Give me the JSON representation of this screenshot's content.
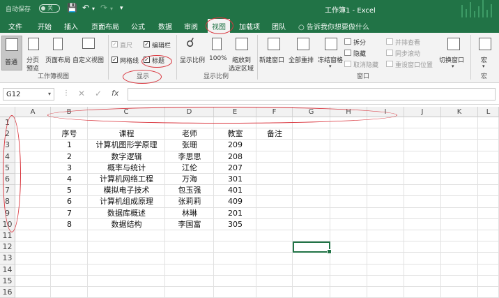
{
  "titlebar": {
    "autosave_label": "自动保存",
    "autosave_state": "关",
    "doc_title": "工作簿1 - Excel"
  },
  "tabs": [
    {
      "label": "文件",
      "active": false
    },
    {
      "label": "开始",
      "active": false
    },
    {
      "label": "插入",
      "active": false
    },
    {
      "label": "页面布局",
      "active": false
    },
    {
      "label": "公式",
      "active": false
    },
    {
      "label": "数据",
      "active": false
    },
    {
      "label": "审阅",
      "active": false
    },
    {
      "label": "视图",
      "active": true
    },
    {
      "label": "加载项",
      "active": false
    },
    {
      "label": "团队",
      "active": false
    }
  ],
  "tell_me": "告诉我你想要做什么",
  "ribbon": {
    "workbook_views": {
      "normal": "普通",
      "page_break_1": "分页",
      "page_break_2": "预览",
      "page_layout": "页面布局",
      "custom_views": "自定义视图",
      "group": "工作簿视图"
    },
    "show": {
      "ruler": "直尺",
      "formula_bar": "编辑栏",
      "gridlines": "网格线",
      "headings": "标题",
      "group": "显示"
    },
    "zoom": {
      "zoom": "显示比例",
      "zoom_100": "100%",
      "zoom_sel_1": "缩放到",
      "zoom_sel_2": "选定区域",
      "group": "显示比例"
    },
    "window": {
      "new_window": "新建窗口",
      "arrange_all": "全部重排",
      "freeze_panes": "冻结窗格",
      "split": "拆分",
      "hide": "隐藏",
      "unhide": "取消隐藏",
      "view_side": "并排查看",
      "sync_scroll": "同步滚动",
      "reset_pos": "重设窗口位置",
      "switch_windows": "切换窗口",
      "group": "窗口"
    },
    "macros": {
      "macro": "宏",
      "group": "宏"
    }
  },
  "namebox": "G12",
  "fx_label": "fx",
  "columns": [
    "A",
    "B",
    "C",
    "D",
    "E",
    "F",
    "G",
    "H",
    "I",
    "J",
    "K",
    "L"
  ],
  "rows": [
    "1",
    "2",
    "3",
    "4",
    "5",
    "6",
    "7",
    "8",
    "9",
    "10",
    "11",
    "12",
    "13",
    "14",
    "15",
    "16",
    "17"
  ],
  "table": {
    "headers": [
      "序号",
      "课程",
      "老师",
      "教室",
      "备注"
    ],
    "rows": [
      [
        "1",
        "计算机图形学原理",
        "张珊",
        "209"
      ],
      [
        "2",
        "数字逻辑",
        "李思思",
        "208"
      ],
      [
        "3",
        "概率与统计",
        "江伦",
        "207"
      ],
      [
        "4",
        "计算机网络工程",
        "万海",
        "301"
      ],
      [
        "5",
        "模拟电子技术",
        "包玉强",
        "401"
      ],
      [
        "6",
        "计算机组成原理",
        "张莉莉",
        "409"
      ],
      [
        "7",
        "数据库概述",
        "林琳",
        "201"
      ],
      [
        "8",
        "数据结构",
        "李国富",
        "305"
      ]
    ]
  },
  "colors": {
    "brand": "#217346",
    "annotation": "#d9363e"
  }
}
